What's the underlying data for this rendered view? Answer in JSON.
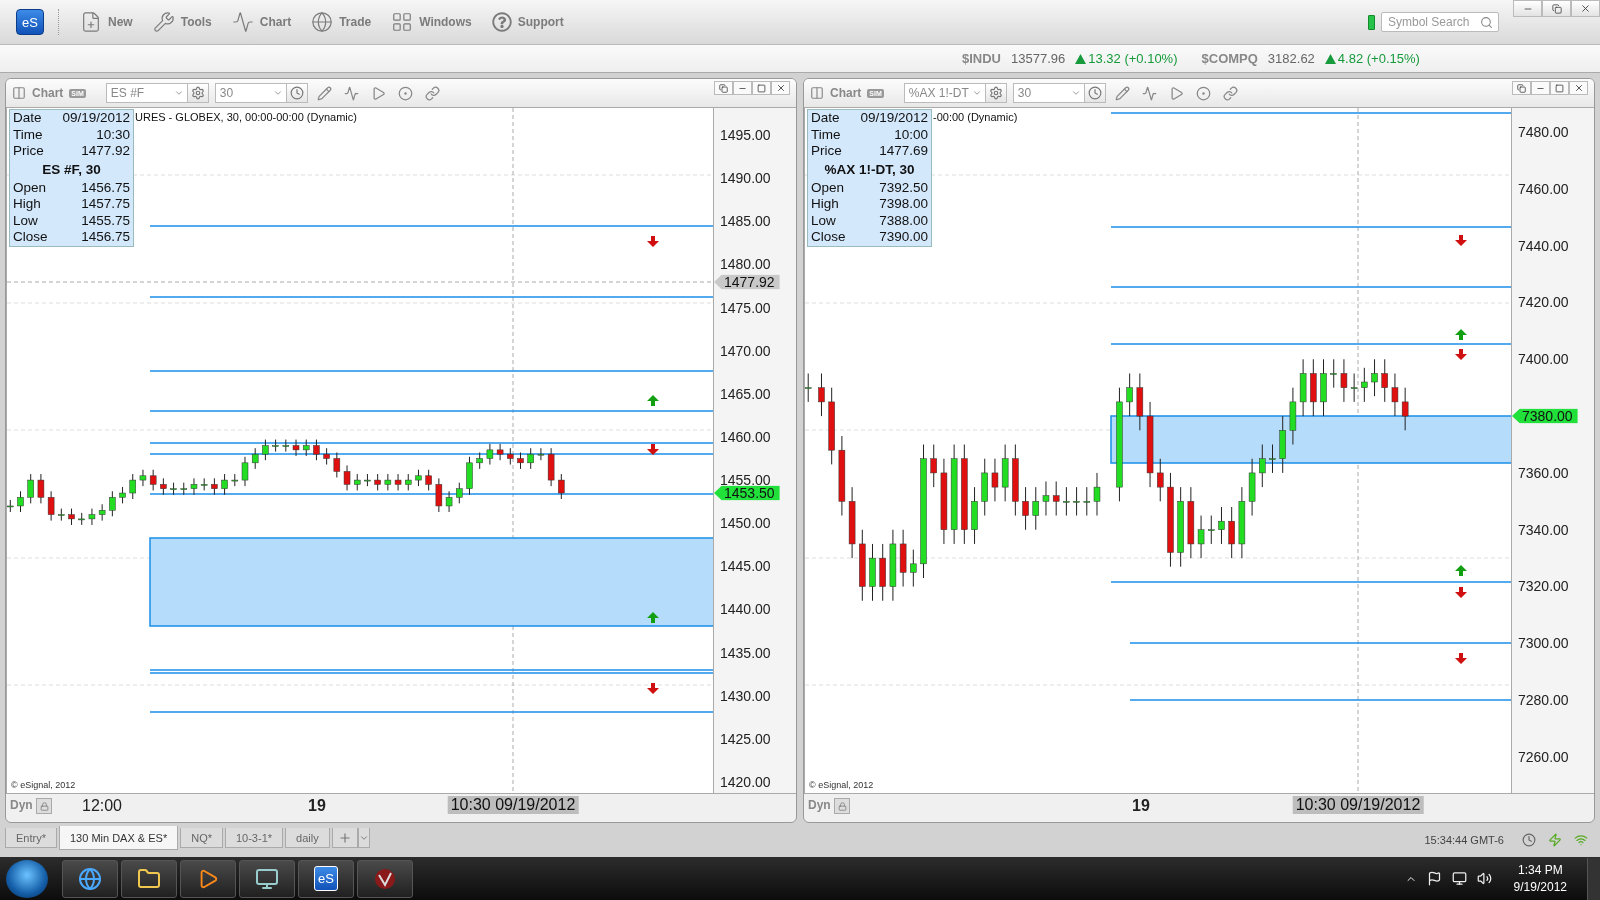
{
  "toolbar": {
    "logo": "eS",
    "buttons": [
      {
        "label": "New"
      },
      {
        "label": "Tools"
      },
      {
        "label": "Chart"
      },
      {
        "label": "Trade"
      },
      {
        "label": "Windows"
      },
      {
        "label": "Support"
      }
    ],
    "symbol_search": {
      "placeholder": "Symbol Search"
    }
  },
  "ticker": [
    {
      "symbol": "$INDU",
      "price": "13577.96",
      "change": "13.32 (+0.10%)",
      "up": true
    },
    {
      "symbol": "$COMPQ",
      "price": "3182.62",
      "change": "4.82 (+0.15%)",
      "up": true
    }
  ],
  "charts": [
    {
      "title": "Chart",
      "badge": "SIM",
      "symbol": "ES #F",
      "interval": "30",
      "series_label": "URES - GLOBEX, 30, 00:00-00:00 (Dynamic)",
      "info": {
        "top": [
          {
            "label": "Date",
            "value": "09/19/2012"
          },
          {
            "label": "Time",
            "value": "10:30"
          },
          {
            "label": "Price",
            "value": "1477.92"
          }
        ],
        "heading": "ES #F, 30",
        "bottom": [
          {
            "label": "Open",
            "value": "1456.75"
          },
          {
            "label": "High",
            "value": "1457.75"
          },
          {
            "label": "Low",
            "value": "1455.75"
          },
          {
            "label": "Close",
            "value": "1456.75"
          }
        ]
      },
      "price_axis": [
        "1495.00",
        "1490.00",
        "1485.00",
        "1480.00",
        "1475.00",
        "1470.00",
        "1465.00",
        "1460.00",
        "1455.00",
        "1450.00",
        "1445.00",
        "1440.00",
        "1435.00",
        "1430.00",
        "1425.00",
        "1420.00"
      ],
      "price_markers": [
        {
          "text": "1477.92",
          "kind": "cursor"
        },
        {
          "text": "1453.50",
          "kind": "last"
        }
      ],
      "copyright": "© eSignal, 2012",
      "dyn": "Dyn",
      "time_labels": [
        {
          "text": "12:00",
          "bold": false
        },
        {
          "text": "19",
          "bold": true
        }
      ],
      "cursor_label": "10:30 09/19/2012"
    },
    {
      "title": "Chart",
      "badge": "SIM",
      "symbol": "%AX 1!-DT",
      "interval": "30",
      "series_label": "-00:00 (Dynamic)",
      "info": {
        "top": [
          {
            "label": "Date",
            "value": "09/19/2012"
          },
          {
            "label": "Time",
            "value": "10:00"
          },
          {
            "label": "Price",
            "value": "1477.69"
          }
        ],
        "heading": "%AX 1!-DT, 30",
        "bottom": [
          {
            "label": "Open",
            "value": "7392.50"
          },
          {
            "label": "High",
            "value": "7398.00"
          },
          {
            "label": "Low",
            "value": "7388.00"
          },
          {
            "label": "Close",
            "value": "7390.00"
          }
        ]
      },
      "price_axis": [
        "7480.00",
        "7460.00",
        "7440.00",
        "7420.00",
        "7400.00",
        "7360.00",
        "7340.00",
        "7320.00",
        "7300.00",
        "7280.00",
        "7260.00"
      ],
      "price_markers": [
        {
          "text": "7380.00",
          "kind": "last"
        }
      ],
      "copyright": "© eSignal, 2012",
      "dyn": "Dyn",
      "time_labels": [
        {
          "text": "19",
          "bold": true
        }
      ],
      "cursor_label": "10:30 09/19/2012"
    }
  ],
  "tabs": [
    {
      "label": "Entry*",
      "selected": false
    },
    {
      "label": "130 Min DAX & ES*",
      "selected": true
    },
    {
      "label": "NQ*",
      "selected": false
    },
    {
      "label": "10-3-1*",
      "selected": false
    },
    {
      "label": "daily",
      "selected": false
    }
  ],
  "status": {
    "time": "15:34:44 GMT-6"
  },
  "taskbar": {
    "apps": [
      {
        "kind": "browser"
      },
      {
        "kind": "folder"
      },
      {
        "kind": "media"
      },
      {
        "kind": "monitor"
      },
      {
        "kind": "logo",
        "label": "eS"
      },
      {
        "kind": "red"
      }
    ],
    "time": "1:34 PM",
    "date": "9/19/2012"
  }
}
